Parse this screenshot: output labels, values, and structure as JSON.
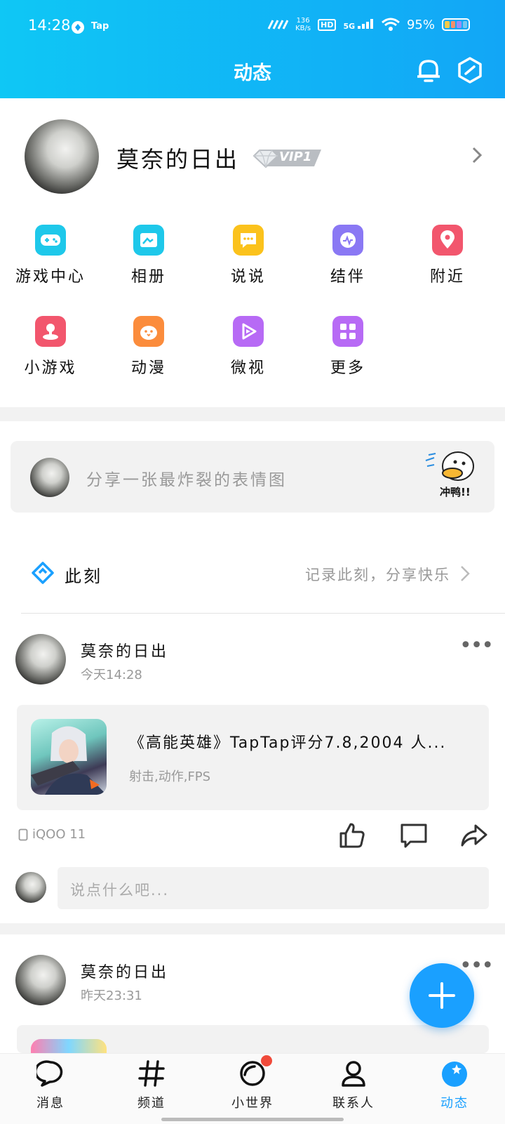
{
  "status_bar": {
    "time": "14:28",
    "app_badge": "Tap",
    "speed_value": "136",
    "speed_unit": "KB/s",
    "hd": "HD",
    "network": "5G",
    "battery": "95%"
  },
  "header": {
    "title": "动态",
    "bell_icon": "bell-icon",
    "settings_icon": "hexagon-settings-icon"
  },
  "profile": {
    "name": "莫奈的日出",
    "vip": "VIP1"
  },
  "grid": [
    {
      "label": "游戏中心",
      "icon": "gamepad-icon",
      "color": "#1ec8ea"
    },
    {
      "label": "相册",
      "icon": "album-icon",
      "color": "#1ec8ea"
    },
    {
      "label": "说说",
      "icon": "chat-bubble-icon",
      "color": "#fbc21c"
    },
    {
      "label": "结伴",
      "icon": "companion-icon",
      "color": "#8a78f4"
    },
    {
      "label": "附近",
      "icon": "location-pin-icon",
      "color": "#f2566d"
    },
    {
      "label": "小游戏",
      "icon": "joystick-icon",
      "color": "#f2566d"
    },
    {
      "label": "动漫",
      "icon": "anime-chick-icon",
      "color": "#fb8c3c"
    },
    {
      "label": "微视",
      "icon": "play-video-icon",
      "color": "#b76af5"
    },
    {
      "label": "更多",
      "icon": "grid-more-icon",
      "color": "#b76af5"
    }
  ],
  "share_bar": {
    "placeholder": "分享一张最炸裂的表情图",
    "sticker_text": "冲鸭!!"
  },
  "moment": {
    "label": "此刻",
    "hint": "记录此刻，分享快乐"
  },
  "posts": [
    {
      "author": "莫奈的日出",
      "time": "今天14:28",
      "game_title": "《高能英雄》TapTap评分7.8,2004 人...",
      "game_tags": "射击,动作,FPS",
      "device": "iQOO 11"
    },
    {
      "author": "莫奈的日出",
      "time": "昨天23:31"
    }
  ],
  "comment": {
    "placeholder": "说点什么吧..."
  },
  "tabs": [
    {
      "label": "消息",
      "icon": "message-icon"
    },
    {
      "label": "频道",
      "icon": "hashtag-icon"
    },
    {
      "label": "小世界",
      "icon": "small-world-icon"
    },
    {
      "label": "联系人",
      "icon": "contacts-icon"
    },
    {
      "label": "动态",
      "icon": "feed-star-icon"
    }
  ],
  "colors": {
    "accent": "#1aa0ff",
    "header_start": "#0fc7f5",
    "header_end": "#12a6f6"
  }
}
